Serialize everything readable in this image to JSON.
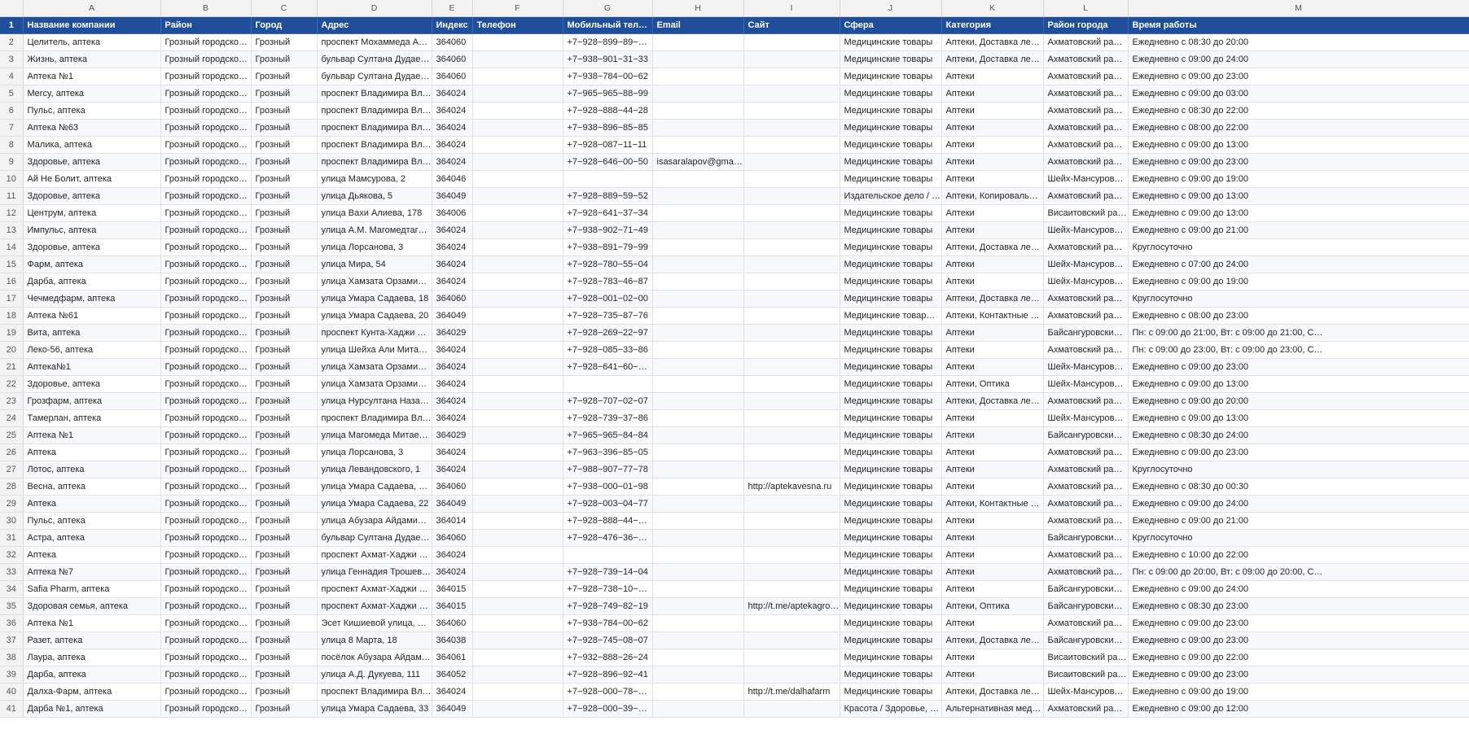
{
  "columns": [
    "A",
    "B",
    "C",
    "D",
    "E",
    "F",
    "G",
    "H",
    "I",
    "J",
    "K",
    "L",
    "M"
  ],
  "headers": [
    "Название компании",
    "Район",
    "Город",
    "Адрес",
    "Индекс",
    "Телефон",
    "Мобильный телефон",
    "Email",
    "Сайт",
    "Сфера",
    "Категория",
    "Район города",
    "Время работы"
  ],
  "rows": [
    [
      "Целитель, аптека",
      "Грозный городской ок…",
      "Грозный",
      "проспект Мохаммеда Али, мо…",
      "364060",
      "",
      "+7−928−899−89−42, +7…",
      "",
      "",
      "Медицинские товары",
      "Аптеки, Доставка лекарств",
      "Ахматовский район",
      "Ежедневно с 08:30 до 20:00"
    ],
    [
      "Жизнь, аптека",
      "Грозный городской ок…",
      "Грозный",
      "бульвар Султана Дудаева, 3",
      "364060",
      "",
      "+7−938−901−31−33",
      "",
      "",
      "Медицинские товары",
      "Аптеки, Доставка лекарств",
      "Ахматовский район",
      "Ежедневно с 09:00 до 24:00"
    ],
    [
      "Аптека №1",
      "Грозный городской ок…",
      "Грозный",
      "бульвар Султана Дудаева, 9",
      "364060",
      "",
      "+7−938−784−00−62",
      "",
      "",
      "Медицинские товары",
      "Аптеки",
      "Ахматовский район",
      "Ежедневно с 09:00 до 23:00"
    ],
    [
      "Mercy, аптека",
      "Грозный городской ок…",
      "Грозный",
      "проспект Владимира Владими…",
      "364024",
      "",
      "+7−965−965−88−99",
      "",
      "",
      "Медицинские товары",
      "Аптеки",
      "Ахматовский район",
      "Ежедневно с 09:00 до 03:00"
    ],
    [
      "Пульс, аптека",
      "Грозный городской ок…",
      "Грозный",
      "проспект Владимира Владими…",
      "364024",
      "",
      "+7−928−888−44−28",
      "",
      "",
      "Медицинские товары",
      "Аптеки",
      "Ахматовский район",
      "Ежедневно с 08:30 до 22:00"
    ],
    [
      "Аптека №63",
      "Грозный городской ок…",
      "Грозный",
      "проспект Владимира Владими…",
      "364024",
      "",
      "+7−938−896−85−85",
      "",
      "",
      "Медицинские товары",
      "Аптеки",
      "Ахматовский район",
      "Ежедневно с 08:00 до 22:00"
    ],
    [
      "Малика, аптека",
      "Грозный городской ок…",
      "Грозный",
      "проспект Владимира Владими…",
      "364024",
      "",
      "+7−928−087−11−11",
      "",
      "",
      "Медицинские товары",
      "Аптеки",
      "Ахматовский район",
      "Ежедневно с 09:00 до 13:00"
    ],
    [
      "Здоровье, аптека",
      "Грозный городской ок…",
      "Грозный",
      "проспект Владимира Владими…",
      "364024",
      "",
      "+7−928−646−00−50",
      "isasaralapov@gmail.com",
      "",
      "Медицинские товары",
      "Аптеки",
      "Ахматовский район",
      "Ежедневно с 09:00 до 23:00"
    ],
    [
      "Ай Не Болит, аптека",
      "Грозный городской ок…",
      "Грозный",
      "улица Мамсурова, 2",
      "364046",
      "",
      "",
      "",
      "",
      "Медицинские товары",
      "Аптеки",
      "Шейх-Мансуровский…",
      "Ежедневно с 09:00 до 19:00"
    ],
    [
      "Здоровье, аптека",
      "Грозный городской ок…",
      "Грозный",
      "улица Дьякова, 5",
      "364049",
      "",
      "+7−928−889−59−52",
      "",
      "",
      "Издательское дело / Поли…",
      "Аптеки, Копировальные ус…",
      "Ахматовский район",
      "Ежедневно с 09:00 до 13:00"
    ],
    [
      "Центрум, аптека",
      "Грозный городской ок…",
      "Грозный",
      "улица Вахи Алиева, 178",
      "364006",
      "",
      "+7−928−641−37−34",
      "",
      "",
      "Медицинские товары",
      "Аптеки",
      "Висаитовский район",
      "Ежедневно с 09:00 до 13:00"
    ],
    [
      "Импульс, аптека",
      "Грозный городской ок…",
      "Грозный",
      "улица А.М. Магомедтагирова, …",
      "364024",
      "",
      "+7−938−902−71−49",
      "",
      "",
      "Медицинские товары",
      "Аптеки",
      "Шейх-Мансуровский…",
      "Ежедневно с 09:00 до 21:00"
    ],
    [
      "Здоровье, аптека",
      "Грозный городской ок…",
      "Грозный",
      "улица Лорсанова, 3",
      "364024",
      "",
      "+7−938−891−79−99",
      "",
      "",
      "Медицинские товары",
      "Аптеки, Доставка лекарств",
      "Ахматовский район",
      "Круглосуточно"
    ],
    [
      "Фарм, аптека",
      "Грозный городской ок…",
      "Грозный",
      "улица Мира, 54",
      "364024",
      "",
      "+7−928−780−55−04",
      "",
      "",
      "Медицинские товары",
      "Аптеки",
      "Шейх-Мансуровский…",
      "Ежедневно с 07:00 до 24:00"
    ],
    [
      "Дарба, аптека",
      "Грозный городской ок…",
      "Грозный",
      "улица Хамзата Орзамиева, 19",
      "364024",
      "",
      "+7−928−783−46−87",
      "",
      "",
      "Медицинские товары",
      "Аптеки",
      "Шейх-Мансуровский…",
      "Ежедневно с 09:00 до 19:00"
    ],
    [
      "Чечмедфарм, аптека",
      "Грозный городской ок…",
      "Грозный",
      "улица Умара Садаева, 18",
      "364060",
      "",
      "+7−928−001−02−00",
      "",
      "",
      "Медицинские товары",
      "Аптеки, Доставка лекарств",
      "Ахматовский район",
      "Круглосуточно"
    ],
    [
      "Аптека №61",
      "Грозный городской ок…",
      "Грозный",
      "улица Умара Садаева, 20",
      "364049",
      "",
      "+7−928−735−87−76",
      "",
      "",
      "Медицинские товары, Оде…",
      "Аптеки, Контактные линзы…",
      "Ахматовский район",
      "Ежедневно с 08:00 до 23:00"
    ],
    [
      "Вита, аптека",
      "Грозный городской ок…",
      "Грозный",
      "проспект Кунта-Хаджи Кишие…",
      "364029",
      "",
      "+7−928−269−22−97",
      "",
      "",
      "Медицинские товары",
      "Аптеки",
      "Байсангуровский рай…",
      "Пн: с 09:00 до 21:00, Вт: с 09:00 до 21:00, С…"
    ],
    [
      "Леко-56, аптека",
      "Грозный городской ок…",
      "Грозный",
      "улица Шейха Али Митаева, 56",
      "364024",
      "",
      "+7−928−085−33−86",
      "",
      "",
      "Медицинские товары",
      "Аптеки",
      "Ахматовский район",
      "Пн: с 09:00 до 23:00, Вт: с 09:00 до 23:00, С…"
    ],
    [
      "Аптека№1",
      "Грозный городской ок…",
      "Грозный",
      "улица Хамзата Орзамиева, 2",
      "364024",
      "",
      "+7−928−641−60−19, +7…",
      "",
      "",
      "Медицинские товары",
      "Аптеки",
      "Шейх-Мансуровский…",
      "Ежедневно с 09:00 до 23:00"
    ],
    [
      "Здоровье, аптека",
      "Грозный городской ок…",
      "Грозный",
      "улица Хамзата Орзамиева, 30а",
      "364024",
      "",
      "",
      "",
      "",
      "Медицинские товары",
      "Аптеки, Оптика",
      "Шейх-Мансуровский…",
      "Ежедневно с 09:00 до 13:00"
    ],
    [
      "Грозфарм, аптека",
      "Грозный городской ок…",
      "Грозный",
      "улица Нурсултана Назарбаева…",
      "364024",
      "",
      "+7−928−707−02−07",
      "",
      "",
      "Медицинские товары",
      "Аптеки, Доставка лекарств",
      "Ахматовский район",
      "Ежедневно с 09:00 до 20:00"
    ],
    [
      "Тамерлан, аптека",
      "Грозный городской ок…",
      "Грозный",
      "проспект Владимира Владими…",
      "364024",
      "",
      "+7−928−739−37−86",
      "",
      "",
      "Медицинские товары",
      "Аптеки",
      "Шейх-Мансуровский…",
      "Ежедневно с 09:00 до 13:00"
    ],
    [
      "Аптека №1",
      "Грозный городской ок…",
      "Грозный",
      "улица Магомеда Митаева, 11",
      "364029",
      "",
      "+7−965−965−84−84",
      "",
      "",
      "Медицинские товары",
      "Аптеки",
      "Байсангуровский рай…",
      "Ежедневно с 08:30 до 24:00"
    ],
    [
      "Аптека",
      "Грозный городской ок…",
      "Грозный",
      "улица Лорсанова, 3",
      "364024",
      "",
      "+7−963−396−85−05",
      "",
      "",
      "Медицинские товары",
      "Аптеки",
      "Ахматовский район",
      "Ежедневно с 09:00 до 23:00"
    ],
    [
      "Лотос, аптека",
      "Грозный городской ок…",
      "Грозный",
      "улица Левандовского, 1",
      "364024",
      "",
      "+7−988−907−77−78",
      "",
      "",
      "Медицинские товары",
      "Аптеки",
      "Ахматовский район",
      "Круглосуточно"
    ],
    [
      "Весна, аптека",
      "Грозный городской ок…",
      "Грозный",
      "улица Умара Садаева, 125",
      "364060",
      "",
      "+7−938−000−01−98",
      "",
      "http://aptekavesna.ru",
      "Медицинские товары",
      "Аптеки",
      "Ахматовский район",
      "Ежедневно с 08:30 до 00:30"
    ],
    [
      "Аптека",
      "Грозный городской ок…",
      "Грозный",
      "улица Умара Садаева, 22",
      "364049",
      "",
      "+7−928−003−04−77",
      "",
      "",
      "Медицинские товары",
      "Аптеки, Контактные линзы…",
      "Ахматовский район",
      "Ежедневно с 09:00 до 24:00"
    ],
    [
      "Пульс, аптека",
      "Грозный городской ок…",
      "Грозный",
      "улица Абузара Айдамирова, 1…",
      "364014",
      "",
      "+7−928−888−44−28, +7…",
      "",
      "",
      "Медицинские товары",
      "Аптеки",
      "Ахматовский район",
      "Ежедневно с 09:00 до 21:00"
    ],
    [
      "Астра, аптека",
      "Грозный городской ок…",
      "Грозный",
      "бульвар Султана Дудаева, 16/1",
      "364060",
      "",
      "+7−928−476−36−95, +7…",
      "",
      "",
      "Медицинские товары",
      "Аптеки",
      "Байсангуровский рай…",
      "Круглосуточно"
    ],
    [
      "Аптека",
      "Грозный городской ок…",
      "Грозный",
      "проспект Ахмат-Хаджи Кадыр…",
      "364024",
      "",
      "",
      "",
      "",
      "Медицинские товары",
      "Аптеки",
      "Ахматовский район",
      "Ежедневно с 10:00 до 22:00"
    ],
    [
      "Аптека №7",
      "Грозный городской ок…",
      "Грозный",
      "улица Геннадия Трошева, 8",
      "364024",
      "",
      "+7−928−739−14−04",
      "",
      "",
      "Медицинские товары",
      "Аптеки",
      "Ахматовский район",
      "Пн: с 09:00 до 20:00, Вт: с 09:00 до 20:00, С…"
    ],
    [
      "Safia Pharm, аптека",
      "Грозный городской ок…",
      "Грозный",
      "проспект Ахмат-Хаджи Кадыр…",
      "364015",
      "",
      "+7−928−738−10−22, +7…",
      "",
      "",
      "Медицинские товары",
      "Аптеки",
      "Байсангуровский рай…",
      "Ежедневно с 09:00 до 24:00"
    ],
    [
      "Здоровая семья, аптека",
      "Грозный городской ок…",
      "Грозный",
      "проспект Ахмат-Хаджи Кадыр…",
      "364015",
      "",
      "+7−928−749−82−19",
      "",
      "http://t.me/aptekagrozn",
      "Медицинские товары",
      "Аптеки, Оптика",
      "Байсангуровский рай…",
      "Ежедневно с 08:30 до 23:00"
    ],
    [
      "Аптека №1",
      "Грозный городской ок…",
      "Грозный",
      "Эсет Кишиевой улица, 32а",
      "364060",
      "",
      "+7−938−784−00−62",
      "",
      "",
      "Медицинские товары",
      "Аптеки",
      "Ахматовский район",
      "Ежедневно с 09:00 до 23:00"
    ],
    [
      "Разет, аптека",
      "Грозный городской ок…",
      "Грозный",
      "улица 8 Марта, 18",
      "364038",
      "",
      "+7−928−745−08−07",
      "",
      "",
      "Медицинские товары",
      "Аптеки, Доставка лекарств",
      "Байсангуровский рай…",
      "Ежедневно с 09:00 до 23:00"
    ],
    [
      "Лаура, аптека",
      "Грозный городской ок…",
      "Грозный",
      "посёлок Абузара Айдамирова…",
      "364061",
      "",
      "+7−932−888−26−24",
      "",
      "",
      "Медицинские товары",
      "Аптеки",
      "Висаитовский район",
      "Ежедневно с 09:00 до 22:00"
    ],
    [
      "Дарба, аптека",
      "Грозный городской ок…",
      "Грозный",
      "улица А.Д. Дукуева, 111",
      "364052",
      "",
      "+7−928−896−92−41",
      "",
      "",
      "Медицинские товары",
      "Аптеки",
      "Висаитовский район",
      "Ежедневно с 09:00 до 23:00"
    ],
    [
      "Далха-Фарм, аптека",
      "Грозный городской ок…",
      "Грозный",
      "проспект Владимира Владими…",
      "364024",
      "",
      "+7−928−000−78−76, +7…",
      "",
      "http://t.me/dalhafarm",
      "Медицинские товары",
      "Аптеки, Доставка лекарств",
      "Шейх-Мансуровский…",
      "Ежедневно с 09:00 до 19:00"
    ],
    [
      "Дарба №1, аптека",
      "Грозный городской ок…",
      "Грозный",
      "улица Умара Садаева, 33",
      "364049",
      "",
      "+7−928−000−39−52, +7…",
      "",
      "",
      "Красота / Здоровье, Меди…",
      "Альтернативная медицина…",
      "Ахматовский район",
      "Ежедневно с 09:00 до 12:00"
    ]
  ],
  "colors": {
    "header_bg": "#1f4e9a",
    "header_text": "#ffffff",
    "grid": "#e1e1e1"
  }
}
